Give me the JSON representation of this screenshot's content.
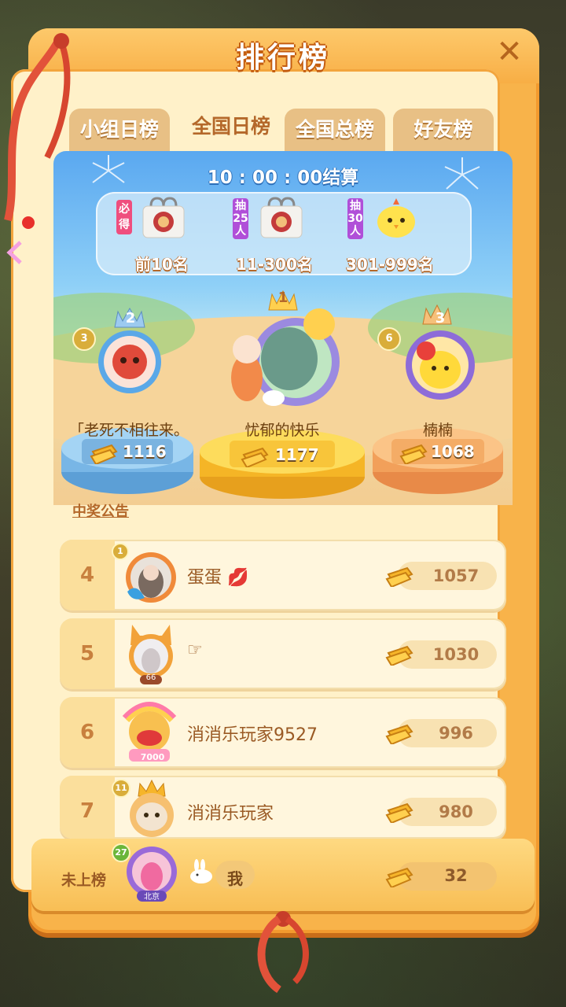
{
  "header": {
    "title": "排行榜",
    "close_icon": "close-icon"
  },
  "tabs": [
    {
      "label": "小组日榜",
      "active": false
    },
    {
      "label": "全国日榜",
      "active": true
    },
    {
      "label": "全国总榜",
      "active": false
    },
    {
      "label": "好友榜",
      "active": false
    }
  ],
  "timer": "10 : 00 : 00结算",
  "rewards": [
    {
      "tag": "必得",
      "tag_color": "#ef4e7e",
      "range": "前10名",
      "icon": "gift-bag-icon"
    },
    {
      "tag": "抽25人",
      "tag_color": "#b04fd8",
      "range": "11-300名",
      "icon": "gift-bag-icon"
    },
    {
      "tag": "抽30人",
      "tag_color": "#b04fd8",
      "range": "301-999名",
      "icon": "chick-icon"
    }
  ],
  "podium": [
    {
      "place": "2",
      "badge": "3",
      "name": "「老死不相往来。",
      "score": "1116"
    },
    {
      "place": "1",
      "name": "忧郁的快乐",
      "score": "1177"
    },
    {
      "place": "3",
      "badge": "6",
      "name": "楠楠",
      "score": "1068"
    }
  ],
  "notice": "中奖公告",
  "rows": [
    {
      "rank": "4",
      "badge": "1",
      "name": "蛋蛋",
      "score": "1057"
    },
    {
      "rank": "5",
      "level": "66",
      "name": "☞",
      "score": "1030"
    },
    {
      "rank": "6",
      "frame_text": "7000",
      "name": "消消乐玩家9527",
      "score": "996"
    },
    {
      "rank": "7",
      "badge": "11",
      "name": "消消乐玩家",
      "score": "980"
    }
  ],
  "me": {
    "label": "未上榜",
    "badge": "27",
    "city": "北京",
    "name": "我",
    "score": "32"
  },
  "colors": {
    "panel": "#f8b34a",
    "accent": "#b4682a",
    "gold": "#f6b52a"
  }
}
